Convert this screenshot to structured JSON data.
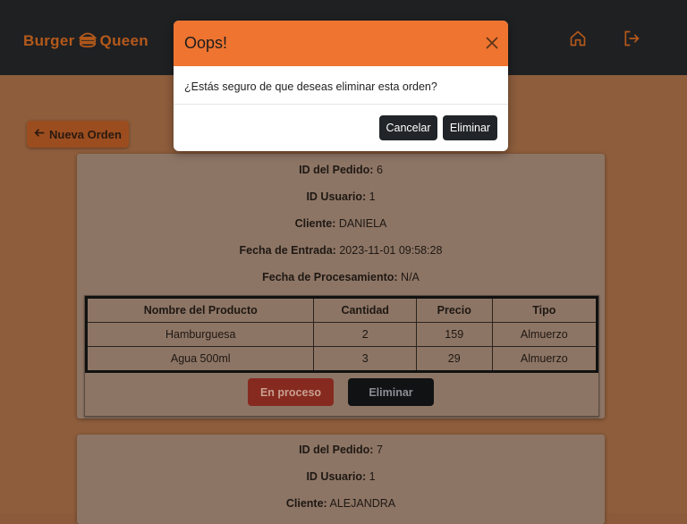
{
  "header": {
    "logo_left": "Burger",
    "logo_right": "Queen",
    "icons": [
      "burger-icon",
      "home-icon",
      "logout-icon"
    ]
  },
  "toolbar": {
    "new_order_label": "Nueva Orden"
  },
  "orders": [
    {
      "id_label": "ID del Pedido:",
      "id_value": "6",
      "user_label": "ID Usuario:",
      "user_value": "1",
      "client_label": "Cliente:",
      "client_value": "DANIELA",
      "entry_label": "Fecha de Entrada:",
      "entry_value": "2023-11-01 09:58:28",
      "processing_label": "Fecha de Procesamiento:",
      "processing_value": "N/A",
      "table": {
        "headers": [
          "Nombre del Producto",
          "Cantidad",
          "Precio",
          "Tipo"
        ],
        "rows": [
          [
            "Hamburguesa",
            "2",
            "159",
            "Almuerzo"
          ],
          [
            "Agua 500ml",
            "3",
            "29",
            "Almuerzo"
          ]
        ]
      },
      "status_button": "En proceso",
      "delete_button": "Eliminar"
    },
    {
      "id_label": "ID del Pedido:",
      "id_value": "7",
      "user_label": "ID Usuario:",
      "user_value": "1",
      "client_label": "Cliente:",
      "client_value": "ALEJANDRA"
    }
  ],
  "modal": {
    "title": "Oops!",
    "message": "¿Estás seguro de que deseas eliminar esta orden?",
    "cancel_label": "Cancelar",
    "confirm_label": "Eliminar"
  },
  "colors": {
    "modal_header": "#ee7430",
    "brand": "#b4591b",
    "status_button": "#862a20",
    "dark_button": "#212529"
  }
}
